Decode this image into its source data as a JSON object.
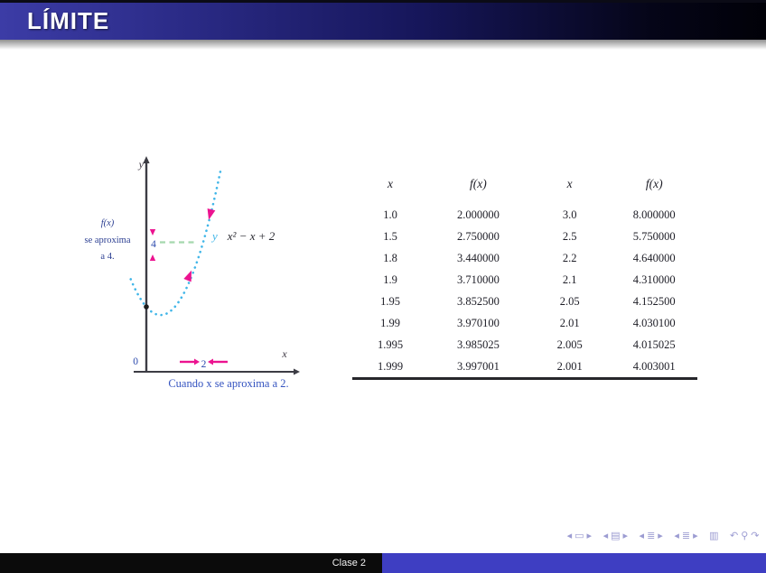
{
  "slide": {
    "title": "LÍMITE",
    "footer": {
      "lecture_label": "Clase 2"
    }
  },
  "figure": {
    "y_axis_label": "y",
    "x_axis_label": "x",
    "origin_label": "0",
    "x_approach_label": "2",
    "y_approach_label": "4",
    "left_annotation": {
      "line1": "f(x)",
      "line2": "se aproxima",
      "line3": "a 4."
    },
    "curve_label": {
      "var": "y",
      "formula": "x² − x + 2"
    },
    "caption": "Cuando x se aproxima a 2.",
    "colors": {
      "curve": "#41b6e8",
      "arrows": "#ec1390",
      "guide_dash": "#a5d8ad",
      "annotation_blue": "#2c4cb0",
      "titlebar_blue": "#3c3ca6",
      "footer_blue": "#3e3ec2"
    }
  },
  "table": {
    "headers": [
      "x",
      "f(x)",
      "x",
      "f(x)"
    ],
    "rows": [
      [
        "1.0",
        "2.000000",
        "3.0",
        "8.000000"
      ],
      [
        "1.5",
        "2.750000",
        "2.5",
        "5.750000"
      ],
      [
        "1.8",
        "3.440000",
        "2.2",
        "4.640000"
      ],
      [
        "1.9",
        "3.710000",
        "2.1",
        "4.310000"
      ],
      [
        "1.95",
        "3.852500",
        "2.05",
        "4.152500"
      ],
      [
        "1.99",
        "3.970100",
        "2.01",
        "4.030100"
      ],
      [
        "1.995",
        "3.985025",
        "2.005",
        "4.015025"
      ],
      [
        "1.999",
        "3.997001",
        "2.001",
        "4.003001"
      ]
    ]
  },
  "nav": {
    "items": [
      {
        "name": "slide-prev",
        "glyph": "◂",
        "gap": false
      },
      {
        "name": "slide-indicator",
        "glyph": "▭",
        "gap": false
      },
      {
        "name": "slide-next",
        "glyph": "▸",
        "gap": false
      },
      {
        "name": "frame-prev",
        "glyph": "◂",
        "gap": true
      },
      {
        "name": "frame-indicator",
        "glyph": "▤",
        "gap": false
      },
      {
        "name": "frame-next",
        "glyph": "▸",
        "gap": false
      },
      {
        "name": "subsection-prev",
        "glyph": "◂",
        "gap": true
      },
      {
        "name": "subsection-indicator",
        "glyph": "≣",
        "gap": false
      },
      {
        "name": "subsection-next",
        "glyph": "▸",
        "gap": false
      },
      {
        "name": "section-prev",
        "glyph": "◂",
        "gap": true
      },
      {
        "name": "section-indicator",
        "glyph": "≣",
        "gap": false
      },
      {
        "name": "section-next",
        "glyph": "▸",
        "gap": false
      },
      {
        "name": "doc-indicator",
        "glyph": "▥",
        "gap": true
      },
      {
        "name": "back",
        "glyph": "↶",
        "gap": true
      },
      {
        "name": "search",
        "glyph": "⚲",
        "gap": false
      },
      {
        "name": "forward",
        "glyph": "↷",
        "gap": false
      }
    ]
  },
  "chart_data": [
    {
      "type": "line",
      "title": "y = x² − x + 2",
      "x": [
        -0.5,
        0,
        0.5,
        1,
        1.5,
        2,
        2.5
      ],
      "y": [
        2.75,
        2,
        1.75,
        2,
        2.75,
        4,
        5.75
      ],
      "xlabel": "x",
      "ylabel": "y",
      "xlim": [
        -0.6,
        2.7
      ],
      "ylim": [
        0,
        6.5
      ],
      "grid": false,
      "annotations": [
        "f(x) se aproxima a 4.",
        "Cuando x se aproxima a 2.",
        "0",
        "2",
        "4"
      ],
      "style": "dotted cyan parabola, magenta approach arrows at x=2 and y=4, green dashed guide at y=4"
    },
    {
      "type": "table",
      "headers": [
        "x",
        "f(x)",
        "x",
        "f(x)"
      ],
      "rows": [
        [
          1.0,
          2.0,
          3.0,
          8.0
        ],
        [
          1.5,
          2.75,
          2.5,
          5.75
        ],
        [
          1.8,
          3.44,
          2.2,
          4.64
        ],
        [
          1.9,
          3.71,
          2.1,
          4.31
        ],
        [
          1.95,
          3.8525,
          2.05,
          4.1525
        ],
        [
          1.99,
          3.9701,
          2.01,
          4.0301
        ],
        [
          1.995,
          3.985025,
          2.005,
          4.015025
        ],
        [
          1.999,
          3.997001,
          2.001,
          4.003001
        ]
      ]
    }
  ]
}
